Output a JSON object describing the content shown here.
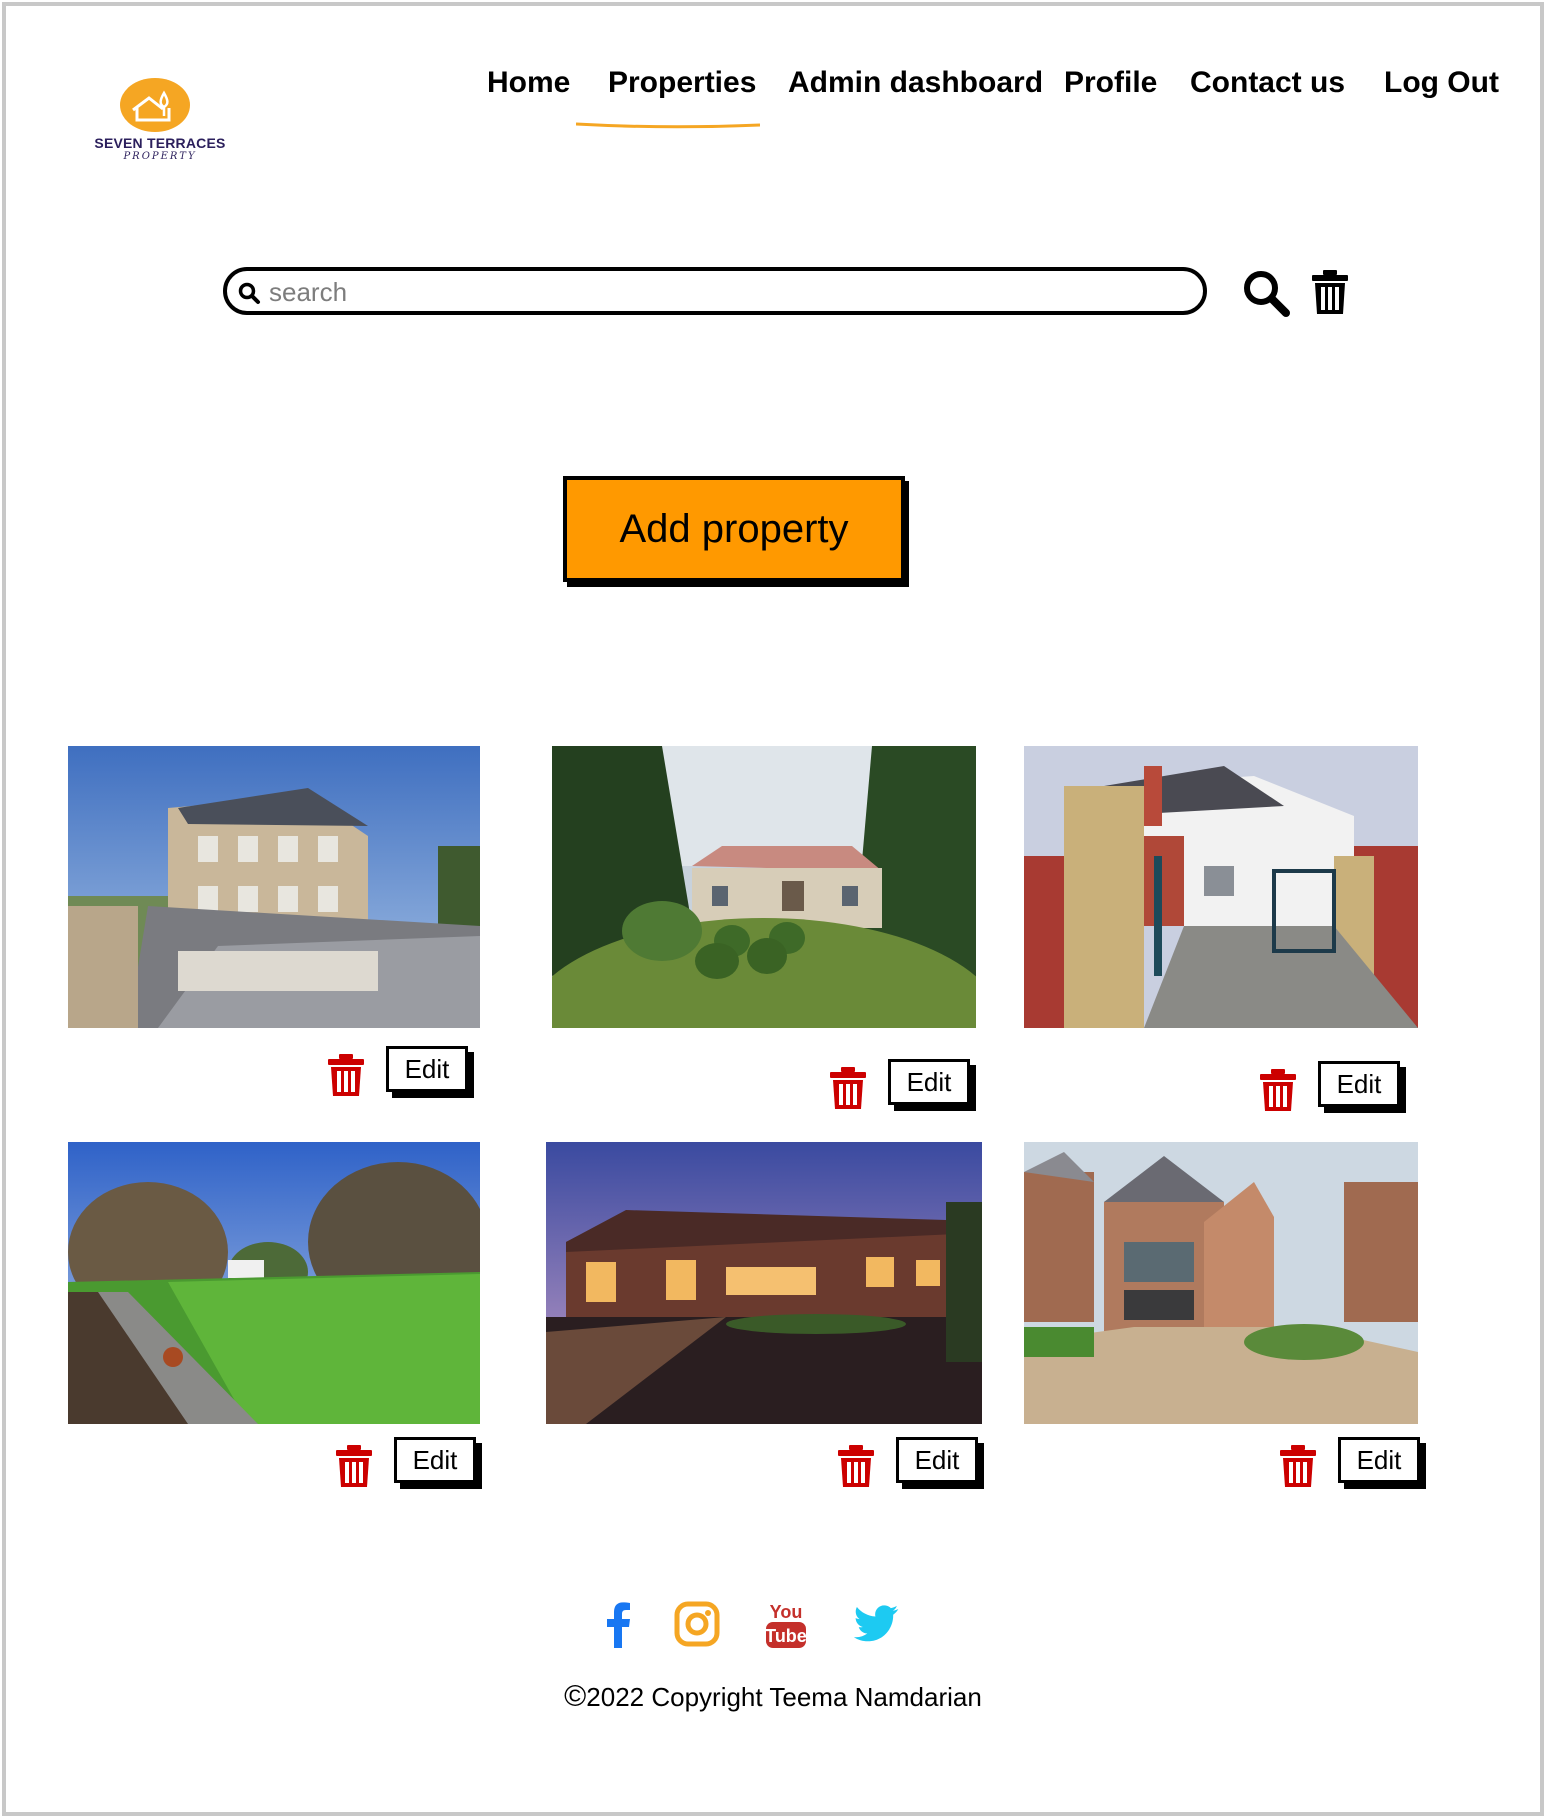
{
  "brand": {
    "name": "SEVEN TERRACES",
    "tagline": "PROPERTY",
    "color_primary": "#f5a623",
    "color_text": "#2b1f5c"
  },
  "nav": {
    "items": [
      {
        "label": "Home",
        "active": false
      },
      {
        "label": "Properties",
        "active": true
      },
      {
        "label": "Admin dashboard",
        "active": false
      },
      {
        "label": "Profile",
        "active": false
      },
      {
        "label": "Contact us",
        "active": false
      },
      {
        "label": "Log Out",
        "active": false
      }
    ],
    "active_underline_color": "#f5a623"
  },
  "search": {
    "placeholder": "search",
    "value": "",
    "search_icon": "search-icon",
    "clear_icon": "trash-icon"
  },
  "actions": {
    "add_property_label": "Add property",
    "add_property_color": "#ff9900"
  },
  "properties": [
    {
      "image": "stone-townhouse-photo",
      "delete_icon": "trash-icon",
      "edit_label": "Edit"
    },
    {
      "image": "bungalow-garden-photo",
      "delete_icon": "trash-icon",
      "edit_label": "Edit"
    },
    {
      "image": "gated-brick-house-photo",
      "delete_icon": "trash-icon",
      "edit_label": "Edit"
    },
    {
      "image": "lawn-garden-photo",
      "delete_icon": "trash-icon",
      "edit_label": "Edit"
    },
    {
      "image": "brick-house-dusk-photo",
      "delete_icon": "trash-icon",
      "edit_label": "Edit"
    },
    {
      "image": "modern-brick-house-photo",
      "delete_icon": "trash-icon",
      "edit_label": "Edit"
    }
  ],
  "delete_color": "#cc0000",
  "footer": {
    "social": [
      {
        "name": "facebook-icon",
        "color": "#1877f2"
      },
      {
        "name": "instagram-icon",
        "color": "#f5a623"
      },
      {
        "name": "youtube-icon",
        "color": "#c4302b"
      },
      {
        "name": "twitter-icon",
        "color": "#1da1f2"
      }
    ],
    "copyright": "2022 Copyright Teema Namdarian",
    "copyright_symbol": "©"
  }
}
